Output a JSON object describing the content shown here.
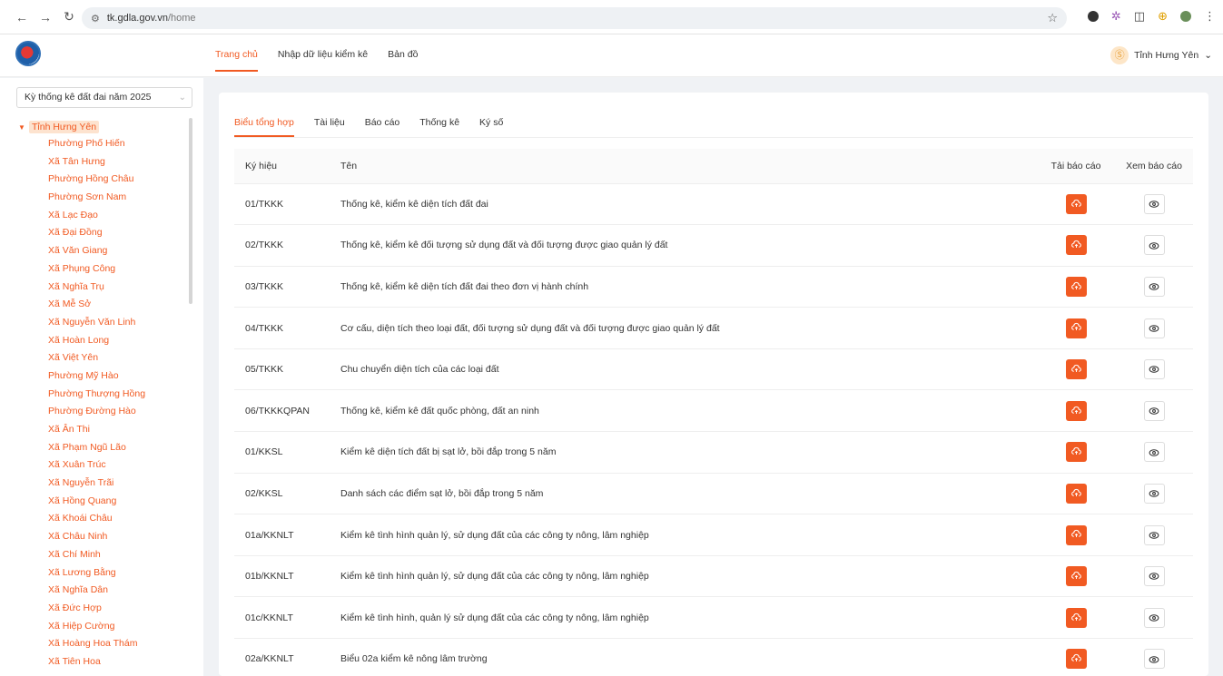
{
  "browser": {
    "url_host": "tk.gdla.gov.vn",
    "url_path": "/home"
  },
  "topnav": {
    "items": [
      {
        "label": "Trang chủ",
        "active": true
      },
      {
        "label": "Nhập dữ liệu kiểm kê",
        "active": false
      },
      {
        "label": "Bản đồ",
        "active": false
      }
    ],
    "user": "Tỉnh Hưng Yên"
  },
  "sidebar": {
    "select_value": "Kỳ thống kê đất đai năm 2025",
    "root": "Tỉnh Hưng Yên",
    "children": [
      "Phường Phố Hiến",
      "Xã Tân Hưng",
      "Phường Hồng Châu",
      "Phường Sơn Nam",
      "Xã Lạc Đạo",
      "Xã Đại Đồng",
      "Xã Văn Giang",
      "Xã Phụng Công",
      "Xã Nghĩa Trụ",
      "Xã Mễ Sở",
      "Xã Nguyễn Văn Linh",
      "Xã Hoàn Long",
      "Xã Việt Yên",
      "Phường Mỹ Hào",
      "Phường Thượng Hồng",
      "Phường Đường Hào",
      "Xã Ân Thi",
      "Xã Phạm Ngũ Lão",
      "Xã Xuân Trúc",
      "Xã Nguyễn Trãi",
      "Xã Hồng Quang",
      "Xã Khoái Châu",
      "Xã Châu Ninh",
      "Xã Chí Minh",
      "Xã Lương Bằng",
      "Xã Nghĩa Dân",
      "Xã Đức Hợp",
      "Xã Hiệp Cường",
      "Xã Hoàng Hoa Thám",
      "Xã Tiên Hoa"
    ]
  },
  "tabs": [
    {
      "label": "Biểu tổng hợp",
      "active": true
    },
    {
      "label": "Tài liệu",
      "active": false
    },
    {
      "label": "Báo cáo",
      "active": false
    },
    {
      "label": "Thống kê",
      "active": false
    },
    {
      "label": "Ký số",
      "active": false
    }
  ],
  "table": {
    "headers": [
      "Ký hiệu",
      "Tên",
      "Tải báo cáo",
      "Xem báo cáo"
    ],
    "rows": [
      {
        "code": "01/TKKK",
        "name": "Thống kê, kiểm kê diện tích đất đai"
      },
      {
        "code": "02/TKKK",
        "name": "Thống kê, kiểm kê đối tượng sử dụng đất và đối tượng được giao quản lý đất"
      },
      {
        "code": "03/TKKK",
        "name": "Thống kê, kiểm kê diện tích đất đai theo đơn vị hành chính"
      },
      {
        "code": "04/TKKK",
        "name": "Cơ cấu, diện tích theo loại đất, đối tượng sử dụng đất và đối tượng được giao quản lý đất"
      },
      {
        "code": "05/TKKK",
        "name": "Chu chuyển diện tích của các loại đất"
      },
      {
        "code": "06/TKKKQPAN",
        "name": "Thống kê, kiểm kê đất quốc phòng, đất an ninh"
      },
      {
        "code": "01/KKSL",
        "name": "Kiểm kê diện tích đất bị sạt lở, bồi đắp trong 5 năm"
      },
      {
        "code": "02/KKSL",
        "name": "Danh sách các điểm sạt lở, bồi đắp trong 5 năm"
      },
      {
        "code": "01a/KKNLT",
        "name": "Kiểm kê tình hình quản lý, sử dụng đất của các công ty nông, lâm nghiệp"
      },
      {
        "code": "01b/KKNLT",
        "name": "Kiểm kê tình hình quản lý, sử dụng đất của các công ty nông, lâm nghiệp"
      },
      {
        "code": "01c/KKNLT",
        "name": "Kiểm kê tình hình, quản lý sử dụng đất của các công ty nông, lâm nghiệp"
      },
      {
        "code": "02a/KKNLT",
        "name": "Biểu 02a kiểm kê nông lâm trường"
      }
    ]
  },
  "colors": {
    "accent": "#f15a22"
  }
}
